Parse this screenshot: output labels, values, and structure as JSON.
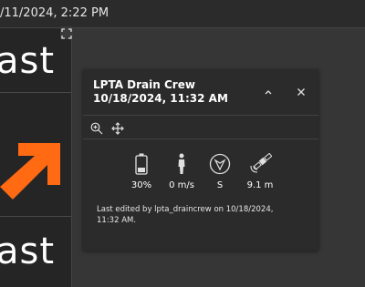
{
  "topbar": {
    "datetime": "/11/2024, 2:22 PM"
  },
  "left_panel": {
    "text_top": "ast",
    "text_bottom": "ast"
  },
  "popup": {
    "title": "LPTA Drain Crew",
    "subtitle": "10/18/2024, 11:32 AM",
    "stats": [
      {
        "icon": "battery-icon",
        "value": "30%"
      },
      {
        "icon": "person-walking-icon",
        "value": "0 m/s"
      },
      {
        "icon": "compass-icon",
        "value": "S"
      },
      {
        "icon": "satellite-icon",
        "value": "9.1 m"
      }
    ],
    "last_edited": "Last edited by lpta_draincrew on 10/18/2024, 11:32 AM."
  },
  "colors": {
    "accent_arrow": "#ff6a13",
    "popup_bg": "#2b2b2b",
    "map_bg": "#363636"
  }
}
